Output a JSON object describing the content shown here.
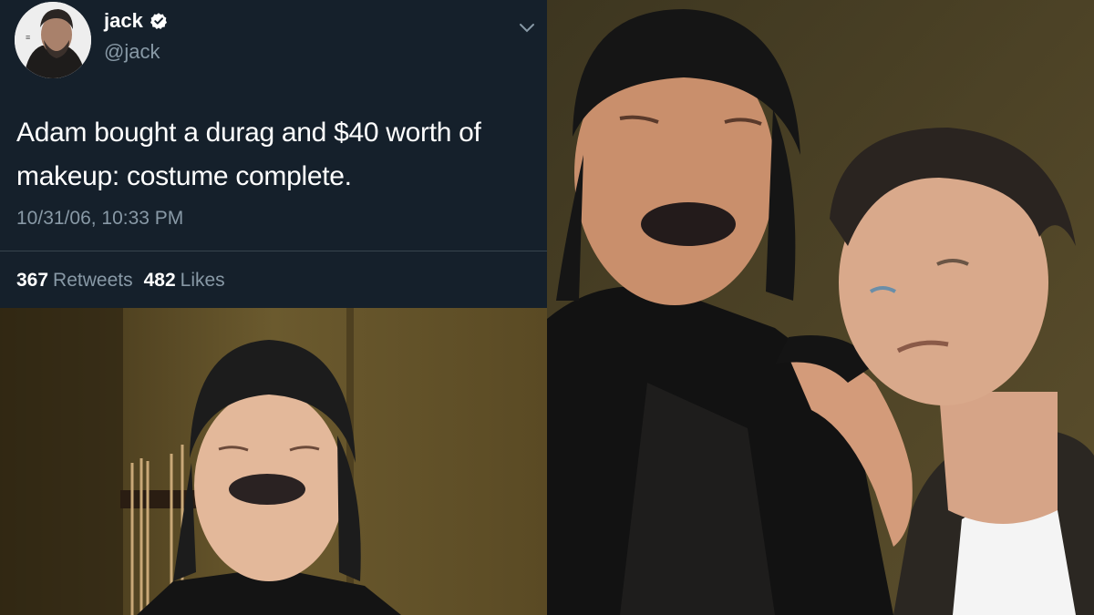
{
  "tweet": {
    "display_name": "jack",
    "handle": "@jack",
    "text_line1": "Adam bought a durag and $40 worth of",
    "text_line2": "makeup: costume complete.",
    "timestamp": "10/31/06, 10:33 PM",
    "retweets_count": "367",
    "retweets_label": "Retweets",
    "likes_count": "482",
    "likes_label": "Likes"
  },
  "colors": {
    "background": "#15202b",
    "text_primary": "#ffffff",
    "text_secondary": "#8899a6",
    "divider": "#38444d",
    "verified_badge": "#ffffff"
  },
  "icons": {
    "verified": "verified-badge-icon",
    "menu": "chevron-down-icon"
  }
}
